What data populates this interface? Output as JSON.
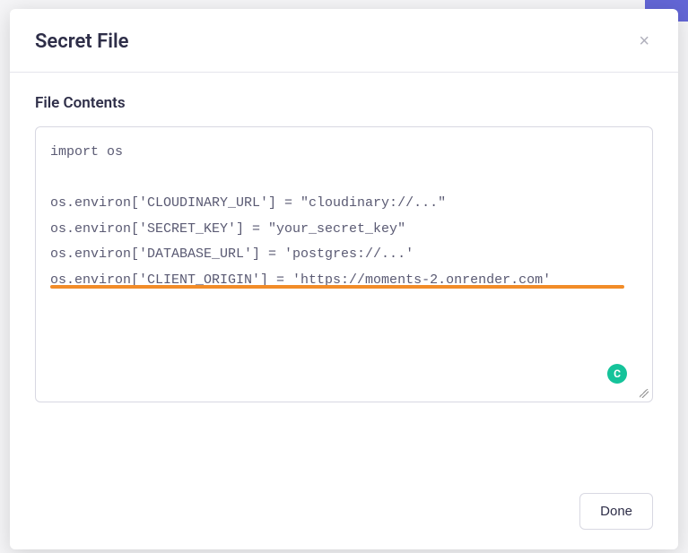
{
  "modal": {
    "title": "Secret File",
    "section_label": "File Contents",
    "code": "import os\n\nos.environ['CLOUDINARY_URL'] = \"cloudinary://...\"\nos.environ['SECRET_KEY'] = \"your_secret_key\"\nos.environ['DATABASE_URL'] = 'postgres://...'\nos.environ['CLIENT_ORIGIN'] = 'https://moments-2.onrender.com'",
    "done_label": "Done",
    "badge_letter": "C"
  }
}
